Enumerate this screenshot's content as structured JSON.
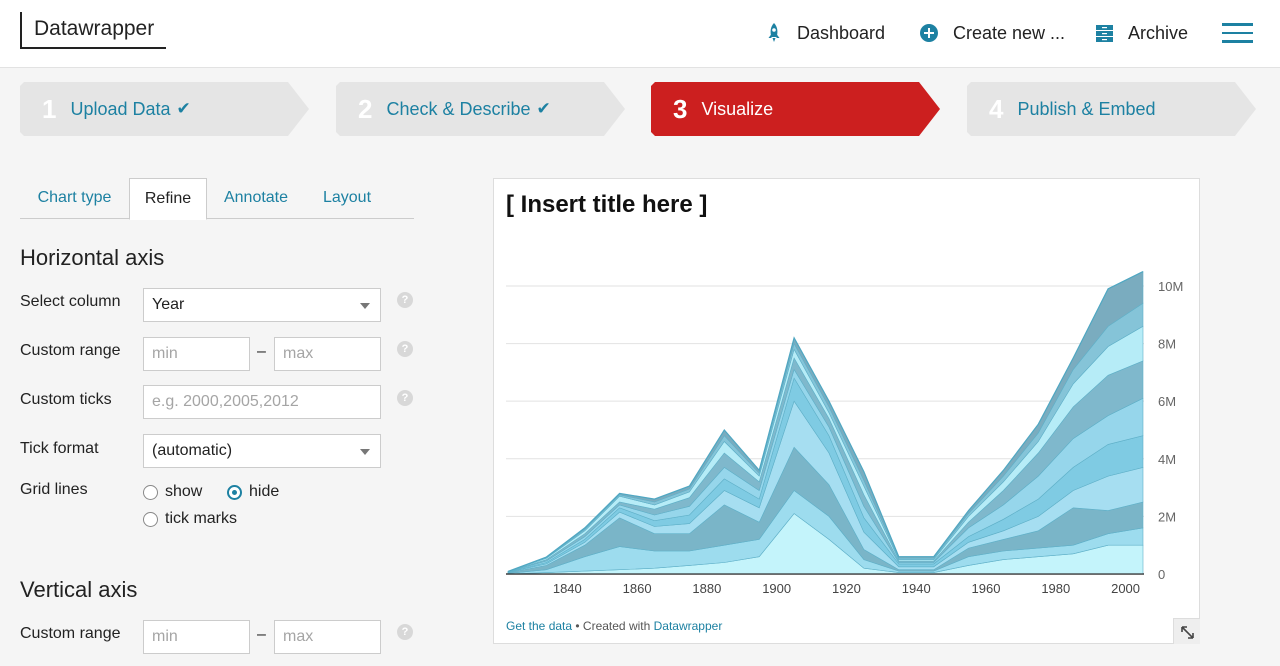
{
  "app": {
    "logo": "Datawrapper"
  },
  "nav": {
    "dashboard": "Dashboard",
    "create_new": "Create new ...",
    "archive": "Archive"
  },
  "steps": [
    {
      "num": "1",
      "label": "Upload Data",
      "state": "done"
    },
    {
      "num": "2",
      "label": "Check & Describe",
      "state": "done"
    },
    {
      "num": "3",
      "label": "Visualize",
      "state": "active"
    },
    {
      "num": "4",
      "label": "Publish & Embed",
      "state": "future"
    }
  ],
  "tabs": [
    "Chart type",
    "Refine",
    "Annotate",
    "Layout"
  ],
  "active_tab": "Refine",
  "horizontal_axis": {
    "title": "Horizontal axis",
    "select_column_label": "Select column",
    "select_column_value": "Year",
    "custom_range_label": "Custom range",
    "min_placeholder": "min",
    "max_placeholder": "max",
    "range_dash": "–",
    "custom_ticks_label": "Custom ticks",
    "custom_ticks_placeholder": "e.g. 2000,2005,2012",
    "tick_format_label": "Tick format",
    "tick_format_value": "(automatic)",
    "grid_lines_label": "Grid lines",
    "grid_options": [
      "show",
      "hide",
      "tick marks"
    ],
    "grid_selected": "hide",
    "help": "?"
  },
  "vertical_axis": {
    "title": "Vertical axis",
    "custom_range_label": "Custom range",
    "min_placeholder": "min",
    "max_placeholder": "max",
    "range_dash": "–"
  },
  "chart": {
    "title": "[ Insert title here ]",
    "footer_link": "Get the data",
    "footer_sep": " • Created with ",
    "footer_brand": "Datawrapper"
  },
  "colors": {
    "accent": "#1d81a2",
    "active_step": "#cc1f1f",
    "step_bg": "#e5e5e5"
  },
  "chart_data": {
    "type": "area",
    "stacked": true,
    "x": [
      1823,
      1834,
      1845,
      1855,
      1865,
      1875,
      1885,
      1895,
      1905,
      1915,
      1925,
      1935,
      1945,
      1955,
      1965,
      1975,
      1985,
      1995,
      2005
    ],
    "y_ticks": [
      "0",
      "2M",
      "4M",
      "6M",
      "8M",
      "10M"
    ],
    "x_ticks": [
      "1840",
      "1860",
      "1880",
      "1900",
      "1920",
      "1940",
      "1960",
      "1980",
      "2000"
    ],
    "xlim": [
      1823,
      2005
    ],
    "ylim": [
      0,
      11700000
    ],
    "grid": "horizontal",
    "series": [
      {
        "values": [
          0.0,
          0.05,
          0.1,
          0.15,
          0.2,
          0.3,
          0.4,
          0.6,
          2.1,
          1.2,
          0.2,
          0.05,
          0.05,
          0.3,
          0.5,
          0.6,
          0.7,
          1.0,
          1.0
        ]
      },
      {
        "values": [
          0.02,
          0.1,
          0.5,
          0.8,
          0.6,
          0.5,
          0.6,
          0.6,
          0.8,
          0.8,
          0.3,
          0.05,
          0.05,
          0.3,
          0.3,
          0.3,
          0.3,
          0.4,
          0.6
        ]
      },
      {
        "values": [
          0.02,
          0.15,
          0.4,
          1.0,
          0.6,
          0.6,
          1.4,
          0.6,
          1.5,
          1.1,
          0.35,
          0.05,
          0.05,
          0.3,
          0.4,
          0.6,
          1.3,
          0.8,
          0.9
        ]
      },
      {
        "values": [
          0.02,
          0.05,
          0.1,
          0.2,
          0.25,
          0.35,
          0.5,
          0.5,
          1.6,
          1.1,
          0.6,
          0.1,
          0.1,
          0.2,
          0.3,
          0.5,
          0.6,
          1.2,
          1.2
        ]
      },
      {
        "values": [
          0.01,
          0.05,
          0.1,
          0.15,
          0.2,
          0.3,
          0.4,
          0.3,
          0.8,
          0.6,
          0.5,
          0.1,
          0.1,
          0.2,
          0.4,
          0.6,
          0.8,
          1.1,
          1.1
        ]
      },
      {
        "values": [
          0.01,
          0.05,
          0.1,
          0.1,
          0.2,
          0.3,
          0.4,
          0.3,
          0.3,
          0.3,
          0.4,
          0.05,
          0.05,
          0.3,
          0.5,
          0.8,
          1.0,
          1.0,
          1.3
        ]
      },
      {
        "values": [
          0.01,
          0.05,
          0.1,
          0.1,
          0.2,
          0.3,
          0.5,
          0.3,
          0.4,
          0.3,
          0.4,
          0.05,
          0.05,
          0.2,
          0.5,
          0.8,
          1.1,
          1.4,
          1.3
        ]
      },
      {
        "values": [
          0.0,
          0.05,
          0.1,
          0.2,
          0.15,
          0.2,
          0.4,
          0.2,
          0.3,
          0.2,
          0.3,
          0.05,
          0.05,
          0.2,
          0.3,
          0.4,
          0.8,
          1.0,
          1.2
        ]
      },
      {
        "values": [
          0.0,
          0.02,
          0.05,
          0.05,
          0.1,
          0.1,
          0.2,
          0.1,
          0.2,
          0.2,
          0.2,
          0.05,
          0.05,
          0.1,
          0.2,
          0.3,
          0.5,
          0.7,
          0.8
        ]
      },
      {
        "values": [
          0.0,
          0.02,
          0.05,
          0.05,
          0.1,
          0.1,
          0.2,
          0.1,
          0.2,
          0.2,
          0.3,
          0.05,
          0.05,
          0.1,
          0.2,
          0.3,
          0.4,
          1.3,
          1.1
        ]
      }
    ]
  }
}
